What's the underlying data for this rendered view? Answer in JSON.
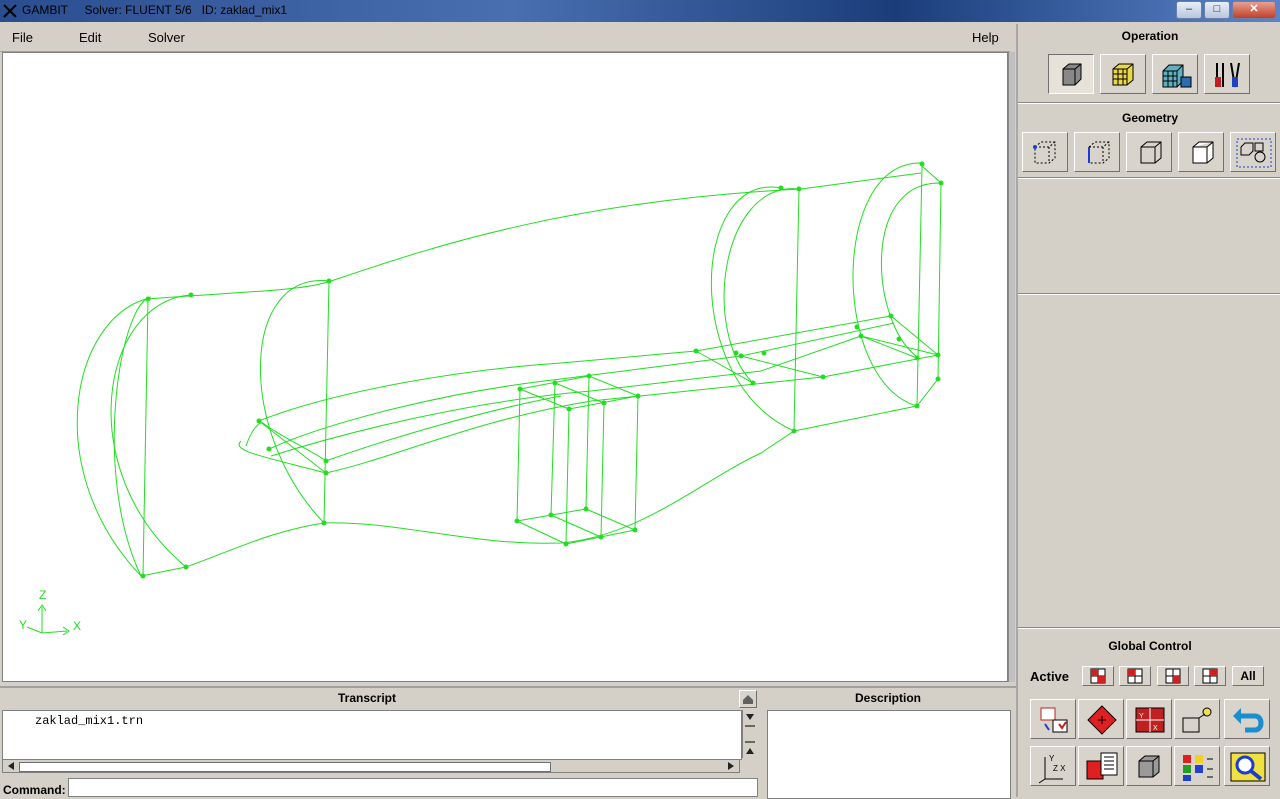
{
  "window": {
    "app": "GAMBIT",
    "solver": "Solver: FLUENT 5/6",
    "id": "ID: zaklad_mix1",
    "minimize": "–",
    "maximize": "□",
    "close": "✕"
  },
  "menu": {
    "file": "File",
    "edit": "Edit",
    "solver": "Solver",
    "help": "Help"
  },
  "axes": {
    "z": "Z",
    "y": "Y",
    "x": "X"
  },
  "panels": {
    "operation": "Operation",
    "geometry": "Geometry",
    "global_control": "Global Control",
    "active": "Active",
    "all": "All"
  },
  "bottom": {
    "transcript_title": "Transcript",
    "description_title": "Description",
    "transcript_text": "zaklad_mix1.trn",
    "command_label": "Command:",
    "command_value": ""
  },
  "colors": {
    "geometry": "#22dd22",
    "viewport_bg": "#ffffff",
    "panel_bg": "#d4d0c8"
  }
}
